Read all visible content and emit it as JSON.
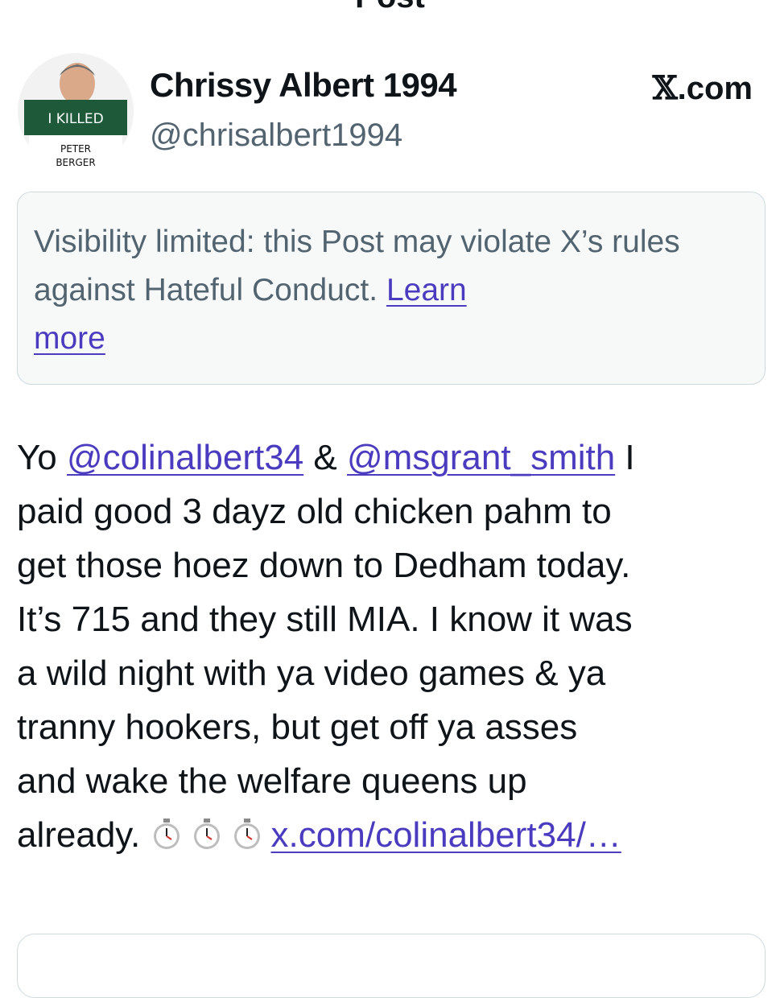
{
  "header": {
    "back_icon": "arrow-left-icon",
    "title": "Post"
  },
  "author": {
    "display_name": "Chrissy Albert 1994",
    "handle": "@chrisalbert1994",
    "avatar_sign_line1": "I KILLED",
    "avatar_sign_line2": "PETER",
    "avatar_sign_line3": "BERGER"
  },
  "source": {
    "logo_glyph": "𝕏",
    "domain": ".com"
  },
  "notice": {
    "text": "Visibility limited: this Post may violate X’s rules against Hateful Conduct.",
    "link_part1": "Learn",
    "link_part2": "more"
  },
  "post": {
    "l1_pre": "Yo ",
    "mention1": "@colinalbert34",
    "l1_mid": " & ",
    "mention2": "@msgrant_smith",
    "l1_post": " I",
    "l2": "paid good 3 dayz old chicken pahm to",
    "l3": "get those hoez down to Dedham today.",
    "l4": "It’s 715 and they still MIA. I know it was",
    "l5": "a wild night with ya video games & ya",
    "l6": "tranny hookers, but get off ya asses",
    "l7": "and wake the welfare queens up",
    "l8": "already. ",
    "emoji_icons": [
      "stopwatch-icon",
      "stopwatch-icon",
      "stopwatch-icon"
    ],
    "link": "x.com/colinalbert34/…"
  },
  "colors": {
    "link": "#4a3bbf",
    "muted": "#536471",
    "text": "#0f1419",
    "sign_green": "#1e5a3a"
  }
}
